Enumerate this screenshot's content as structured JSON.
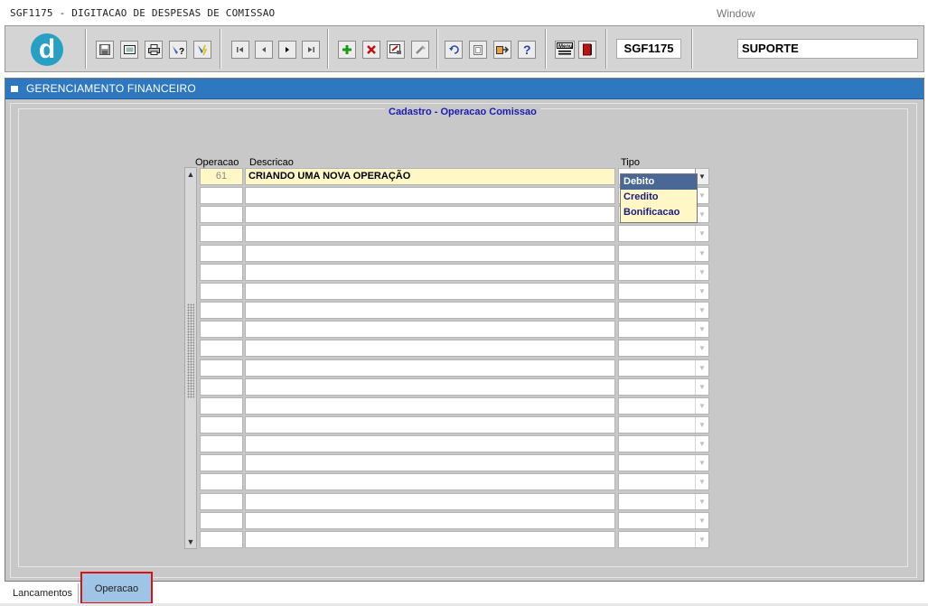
{
  "window": {
    "title": "SGF1175 - DIGITACAO DE DESPESAS DE COMISSAO",
    "menu_label": "Window"
  },
  "toolbar": {
    "logo_letter": "d",
    "module_code": "SGF1175",
    "user": "SUPORTE",
    "buttons": [
      "save-icon",
      "print-preview-icon",
      "print-icon",
      "help-query-icon",
      "execute-query-icon",
      "first-record-icon",
      "previous-record-icon",
      "next-record-icon",
      "last-record-icon",
      "insert-record-icon",
      "delete-record-icon",
      "edit-record-icon",
      "clear-record-icon",
      "undo-icon",
      "copy-icon",
      "run-icon",
      "help-icon",
      "menu-icon",
      "exit-icon"
    ],
    "menu_button_label": "Menu"
  },
  "main": {
    "header_title": "GERENCIAMENTO FINANCEIRO",
    "frame_title": "Cadastro - Operacao Comissao",
    "columns": {
      "operacao": "Operacao",
      "descricao": "Descricao",
      "tipo": "Tipo"
    },
    "rows": [
      {
        "operacao": "61",
        "descricao": "CRIANDO UMA NOVA OPERAÇÃO",
        "tipo": ""
      },
      {
        "operacao": "",
        "descricao": "",
        "tipo": ""
      },
      {
        "operacao": "",
        "descricao": "",
        "tipo": ""
      },
      {
        "operacao": "",
        "descricao": "",
        "tipo": ""
      },
      {
        "operacao": "",
        "descricao": "",
        "tipo": ""
      },
      {
        "operacao": "",
        "descricao": "",
        "tipo": ""
      },
      {
        "operacao": "",
        "descricao": "",
        "tipo": ""
      },
      {
        "operacao": "",
        "descricao": "",
        "tipo": ""
      },
      {
        "operacao": "",
        "descricao": "",
        "tipo": ""
      },
      {
        "operacao": "",
        "descricao": "",
        "tipo": ""
      },
      {
        "operacao": "",
        "descricao": "",
        "tipo": ""
      },
      {
        "operacao": "",
        "descricao": "",
        "tipo": ""
      },
      {
        "operacao": "",
        "descricao": "",
        "tipo": ""
      },
      {
        "operacao": "",
        "descricao": "",
        "tipo": ""
      },
      {
        "operacao": "",
        "descricao": "",
        "tipo": ""
      },
      {
        "operacao": "",
        "descricao": "",
        "tipo": ""
      },
      {
        "operacao": "",
        "descricao": "",
        "tipo": ""
      },
      {
        "operacao": "",
        "descricao": "",
        "tipo": ""
      },
      {
        "operacao": "",
        "descricao": "",
        "tipo": ""
      },
      {
        "operacao": "",
        "descricao": "",
        "tipo": ""
      }
    ],
    "tipo_options": [
      "Debito",
      "Credito",
      "Bonificacao"
    ],
    "tipo_selected": "Debito"
  },
  "tabs": [
    {
      "label": "Lancamentos",
      "active": false
    },
    {
      "label": "Operacao",
      "active": true
    }
  ],
  "colors": {
    "header_bar": "#2e78c0",
    "current_row": "#fff8c6",
    "selected_option": "#4a6896",
    "frame_title": "#1a1ab4",
    "highlight_box": "#e01010"
  }
}
